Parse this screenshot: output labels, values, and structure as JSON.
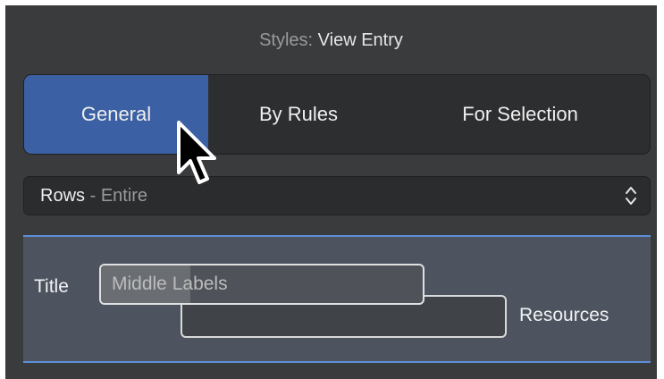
{
  "header": {
    "lead": "Styles:",
    "title": "View Entry"
  },
  "tabs": [
    {
      "label": "General",
      "active": true
    },
    {
      "label": "By Rules",
      "active": false
    },
    {
      "label": "For Selection",
      "active": false
    }
  ],
  "dropdown": {
    "value": "Rows",
    "separator": "-",
    "sub": "Entire",
    "icon": "chevron-up-down-icon"
  },
  "preview": {
    "title_label": "Title",
    "primary_text": "Middle",
    "secondary_text": "Labels",
    "resources_label": "Resources"
  },
  "colors": {
    "accent": "#3b60a3",
    "divider": "#5c8fd8",
    "panel": "#3a3b3d"
  },
  "cursor": {
    "icon": "arrow-cursor-icon"
  }
}
